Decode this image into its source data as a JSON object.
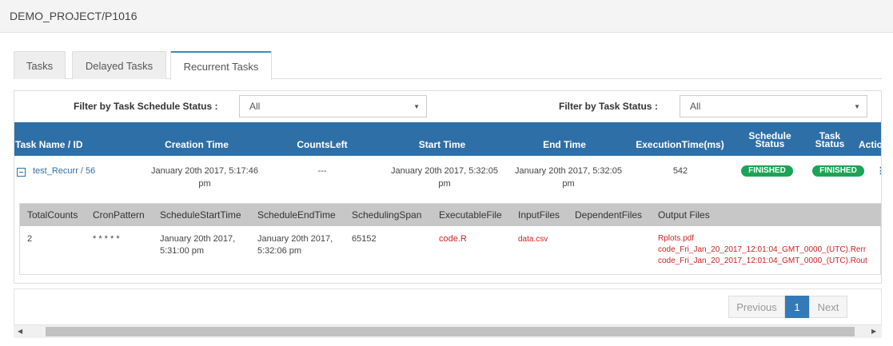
{
  "breadcrumb": "DEMO_PROJECT/P1016",
  "tabs": [
    "Tasks",
    "Delayed Tasks",
    "Recurrent Tasks"
  ],
  "filters": {
    "schedule_label": "Filter by Task Schedule Status :",
    "schedule_value": "All",
    "status_label": "Filter by Task Status :",
    "status_value": "All"
  },
  "table": {
    "headers": {
      "name": "Task Name / ID",
      "creation": "Creation Time",
      "counts": "CountsLeft",
      "start": "Start Time",
      "end": "End Time",
      "exec": "ExecutionTime(ms)",
      "sched1": "Schedule",
      "sched2": "Status",
      "task1": "Task",
      "task2": "Status",
      "action": "Actio"
    },
    "row": {
      "name": "test_Recurr / 56",
      "creation1": "January 20th 2017, 5:17:46",
      "creation2": "pm",
      "counts": "---",
      "start1": "January 20th 2017, 5:32:05",
      "start2": "pm",
      "end1": "January 20th 2017, 5:32:05",
      "end2": "pm",
      "exec": "542",
      "schedule_status": "FINISHED",
      "task_status": "FINISHED"
    }
  },
  "detail": {
    "headers": [
      "TotalCounts",
      "CronPattern",
      "ScheduleStartTime",
      "ScheduleEndTime",
      "SchedulingSpan",
      "ExecutableFile",
      "InputFiles",
      "DependentFiles",
      "Output Files"
    ],
    "total": "2",
    "cron": "* * * * *",
    "sst1": "January 20th 2017,",
    "sst2": "5:31:00 pm",
    "set1": "January 20th 2017,",
    "set2": "5:32:06 pm",
    "span": "65152",
    "exe": "code.R",
    "input": "data.csv",
    "out1": "Rplots.pdf",
    "out2": "code_Fri_Jan_20_2017_12:01:04_GMT_0000_(UTC).Rerr",
    "out3": "code_Fri_Jan_20_2017_12:01:04_GMT_0000_(UTC).Rout"
  },
  "pager": {
    "prev": "Previous",
    "page": "1",
    "next": "Next"
  },
  "colors": {
    "header": "#2f6fa7",
    "finished": "#1aa554",
    "file_red": "#cc2222",
    "active_page": "#337ab7"
  }
}
